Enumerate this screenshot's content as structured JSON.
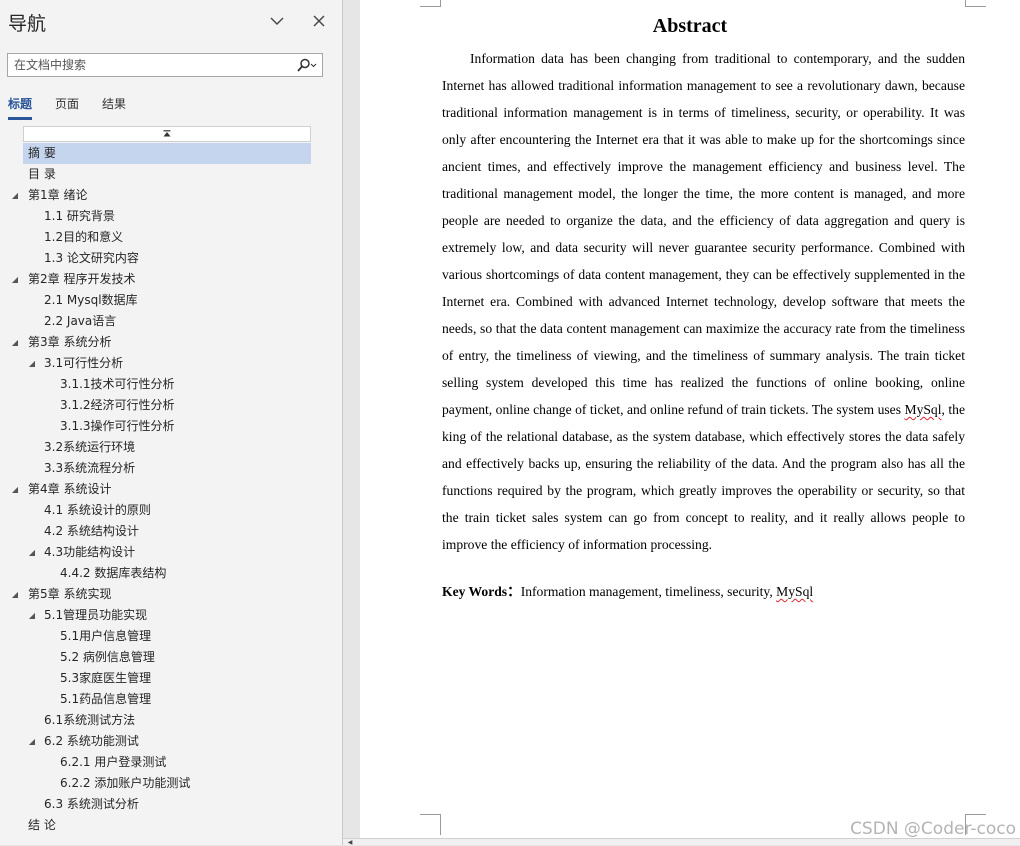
{
  "nav": {
    "title": "导航",
    "search_placeholder": "在文档中搜索",
    "tabs": [
      {
        "label": "标题",
        "active": true
      },
      {
        "label": "页面",
        "active": false
      },
      {
        "label": "结果",
        "active": false
      }
    ],
    "outline": [
      {
        "label": "摘  要",
        "level": 1,
        "expander": "",
        "selected": true
      },
      {
        "label": "目  录",
        "level": 1,
        "expander": ""
      },
      {
        "label": "第1章 绪论",
        "level": 1,
        "expander": "◢"
      },
      {
        "label": "1.1 研究背景",
        "level": 2,
        "expander": ""
      },
      {
        "label": "1.2目的和意义",
        "level": 2,
        "expander": ""
      },
      {
        "label": "1.3 论文研究内容",
        "level": 2,
        "expander": ""
      },
      {
        "label": "第2章 程序开发技术",
        "level": 1,
        "expander": "◢"
      },
      {
        "label": "2.1 Mysql数据库",
        "level": 2,
        "expander": ""
      },
      {
        "label": "2.2 Java语言",
        "level": 2,
        "expander": ""
      },
      {
        "label": "第3章 系统分析",
        "level": 1,
        "expander": "◢"
      },
      {
        "label": "3.1可行性分析",
        "level": 2,
        "expander": "◢"
      },
      {
        "label": "3.1.1技术可行性分析",
        "level": 3,
        "expander": ""
      },
      {
        "label": "3.1.2经济可行性分析",
        "level": 3,
        "expander": ""
      },
      {
        "label": "3.1.3操作可行性分析",
        "level": 3,
        "expander": ""
      },
      {
        "label": "3.2系统运行环境",
        "level": 2,
        "expander": ""
      },
      {
        "label": "3.3系统流程分析",
        "level": 2,
        "expander": ""
      },
      {
        "label": "第4章 系统设计",
        "level": 1,
        "expander": "◢"
      },
      {
        "label": "4.1 系统设计的原则",
        "level": 2,
        "expander": ""
      },
      {
        "label": "4.2 系统结构设计",
        "level": 2,
        "expander": ""
      },
      {
        "label": "4.3功能结构设计",
        "level": 2,
        "expander": "◢"
      },
      {
        "label": "4.4.2 数据库表结构",
        "level": 3,
        "expander": ""
      },
      {
        "label": "第5章 系统实现",
        "level": 1,
        "expander": "◢"
      },
      {
        "label": "5.1管理员功能实现",
        "level": 2,
        "expander": "◢"
      },
      {
        "label": "5.1用户信息管理",
        "level": 3,
        "expander": ""
      },
      {
        "label": "5.2 病例信息管理",
        "level": 3,
        "expander": ""
      },
      {
        "label": "5.3家庭医生管理",
        "level": 3,
        "expander": ""
      },
      {
        "label": "5.1药品信息管理",
        "level": 3,
        "expander": ""
      },
      {
        "label": "6.1系统测试方法",
        "level": 2,
        "expander": ""
      },
      {
        "label": "6.2 系统功能测试",
        "level": 2,
        "expander": "◢"
      },
      {
        "label": "6.2.1 用户登录测试",
        "level": 3,
        "expander": ""
      },
      {
        "label": "6.2.2 添加账户功能测试",
        "level": 3,
        "expander": ""
      },
      {
        "label": "6.3 系统测试分析",
        "level": 2,
        "expander": ""
      },
      {
        "label": "结  论",
        "level": 1,
        "expander": ""
      }
    ]
  },
  "document": {
    "title": "Abstract",
    "body_before": "Information data has been changing from traditional to contemporary, and the sudden Internet has allowed traditional information management to see a revolutionary dawn, because traditional information management is in terms of timeliness, security, or operability. It was only after encountering the Internet era that it was able to make up for the shortcomings since ancient times, and effectively improve the management efficiency and business level. The traditional management model, the longer the time, the more content is managed, and more people are needed to organize the data, and the efficiency of data aggregation and query is extremely low, and data security will never guarantee security performance. Combined with various shortcomings of data content management, they can be effectively supplemented in the Internet era. Combined with advanced Internet technology, develop software that meets the needs, so that the data content management can maximize the accuracy rate from the timeliness of entry, the timeliness of viewing, and the timeliness of summary analysis. The train ticket selling system developed this time has realized the functions of online booking, online payment, online change of ticket, and online refund of train tickets. The system uses ",
    "body_term": "MySql",
    "body_after": ", the king of the relational database, as the system database, which effectively stores the data safely and effectively backs up, ensuring the reliability of the data. And the program also has all the functions required by the program, which greatly improves the operability or security, so that the train ticket sales system can go from concept to reality, and it really allows people to improve the efficiency of information processing.",
    "keywords_label": "Key Words：",
    "keywords_text": "Information management, timeliness, security, ",
    "keywords_term": "MySql"
  },
  "watermark": "CSDN @Coder-coco",
  "icons": {
    "collapse": "chevron-down-icon",
    "close": "close-icon",
    "search": "search-icon",
    "collapse_all": "collapse-all-icon"
  },
  "colors": {
    "accent": "#2b579a",
    "selection": "#c6d5ee",
    "spellcheck": "#dd2233"
  }
}
